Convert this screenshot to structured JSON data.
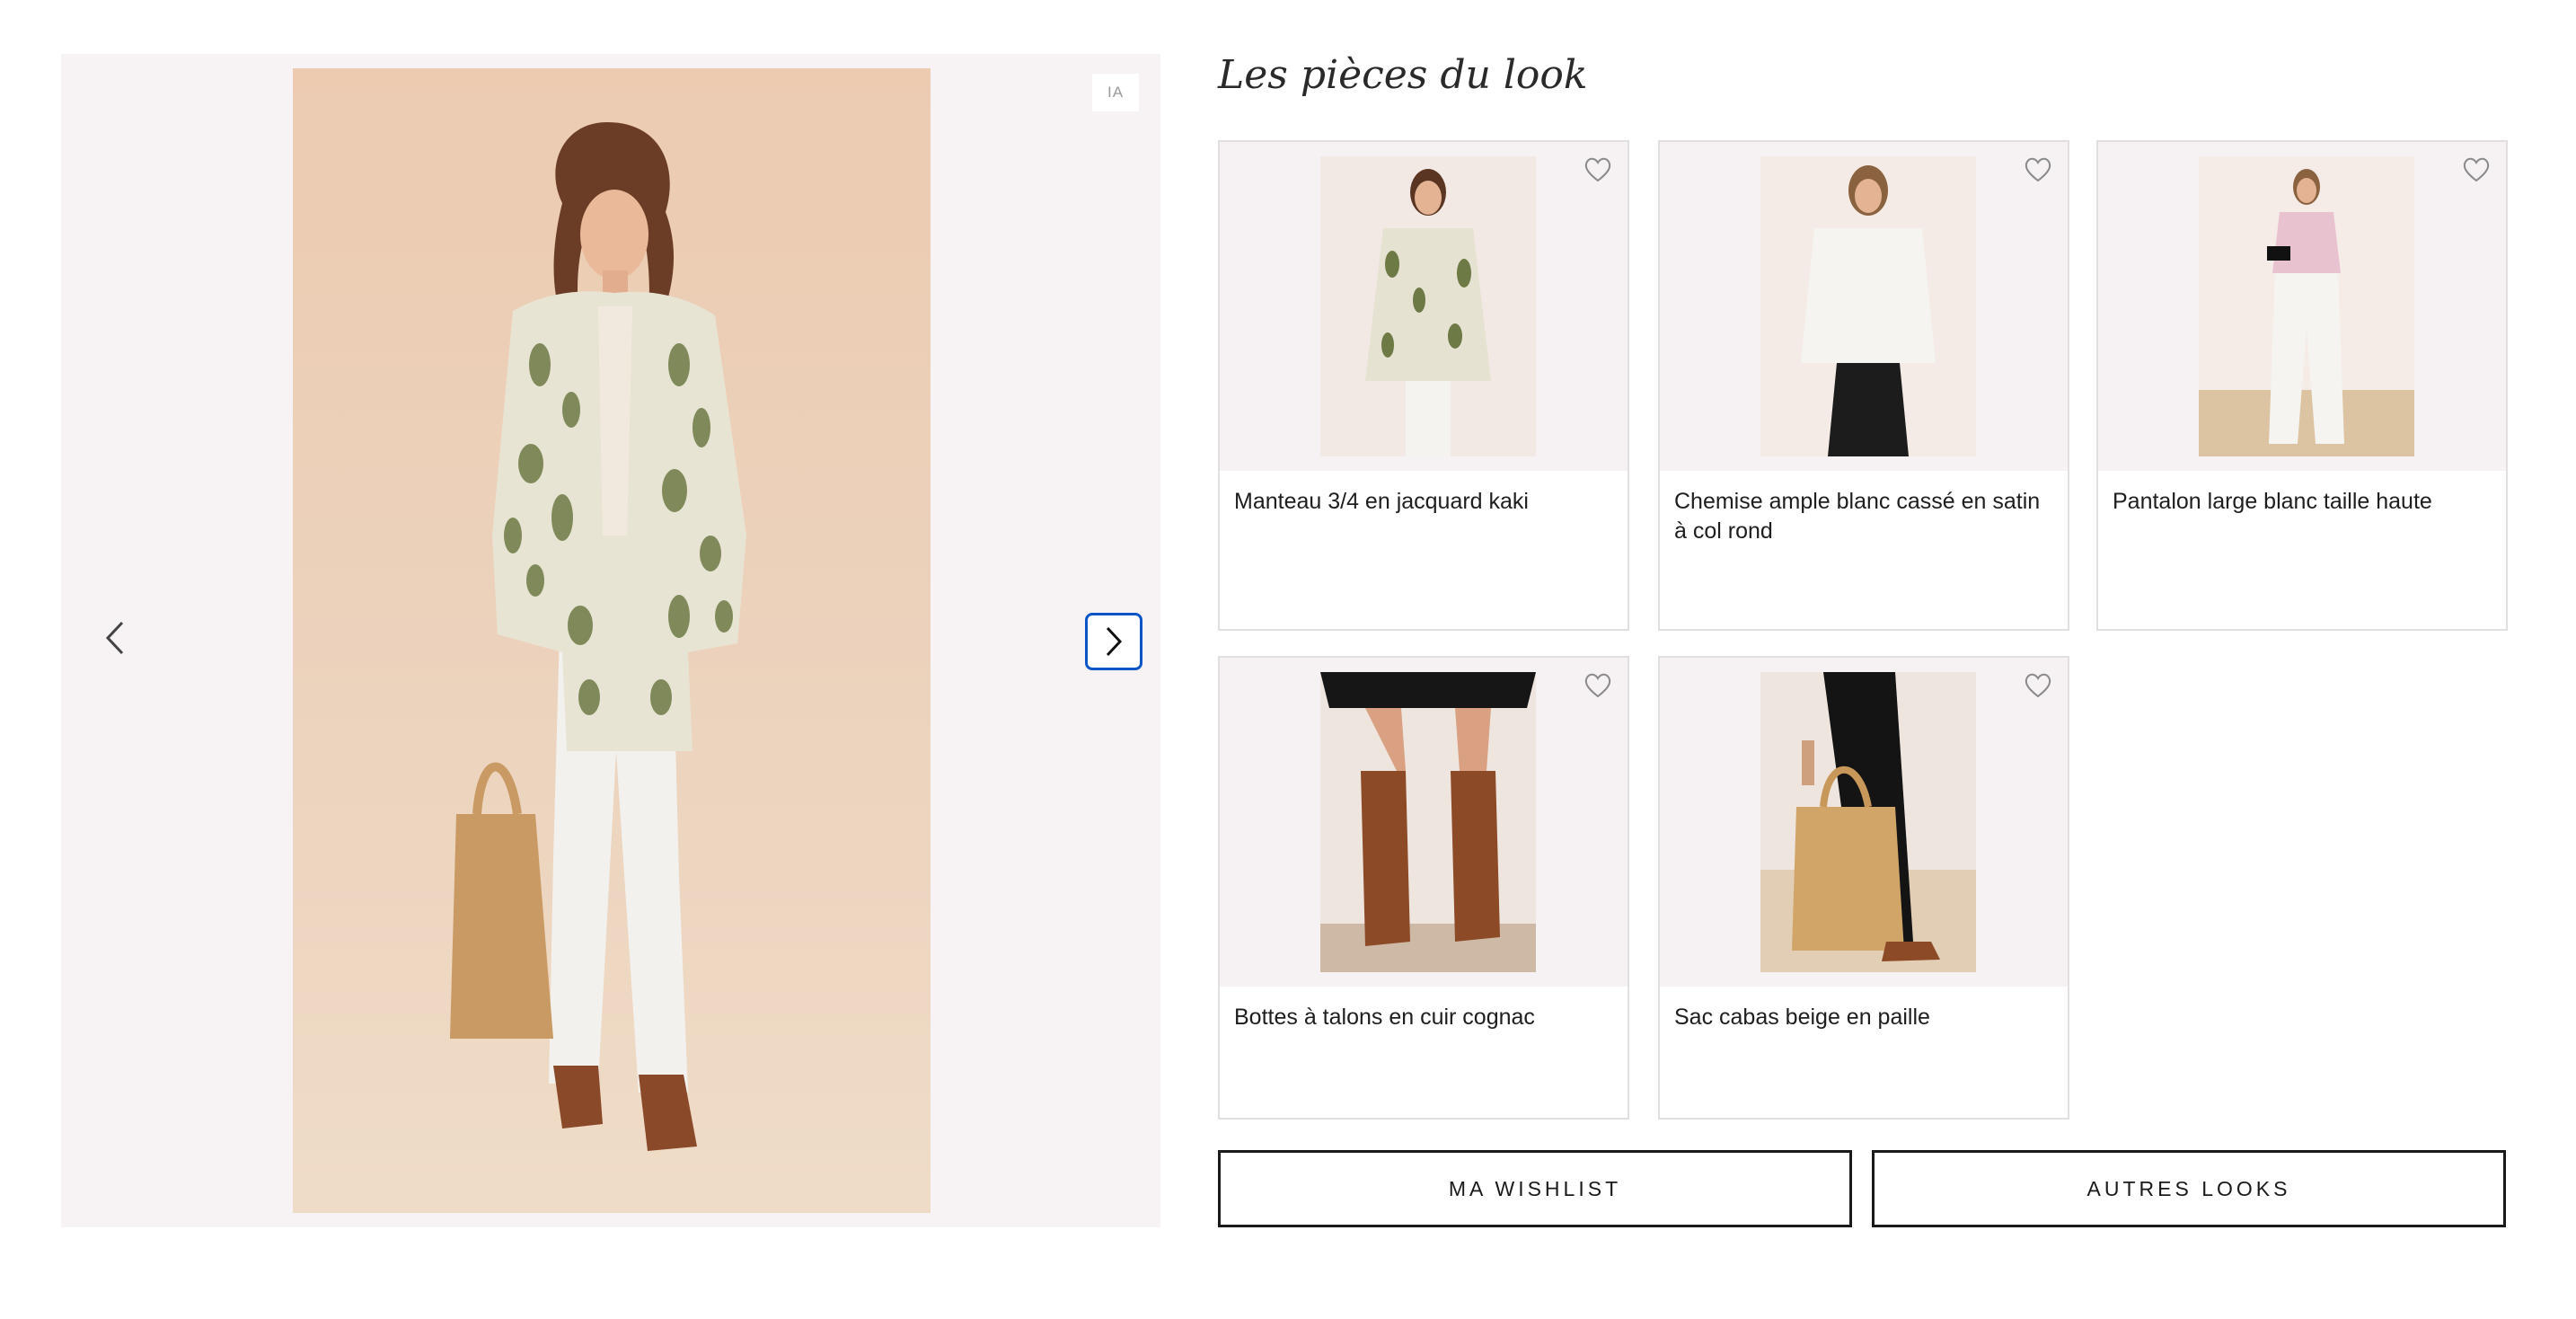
{
  "hero": {
    "badge": "IA",
    "prev_icon": "chevron-left-icon",
    "next_icon": "chevron-right-icon"
  },
  "section_title": "Les pièces du look",
  "products": [
    {
      "name": "Manteau 3/4 en jacquard kaki",
      "icon": "heart-icon"
    },
    {
      "name": "Chemise ample blanc cassé en satin à col rond",
      "icon": "heart-icon"
    },
    {
      "name": "Pantalon large blanc taille haute",
      "icon": "heart-icon"
    },
    {
      "name": "Bottes à talons en cuir cognac",
      "icon": "heart-icon"
    },
    {
      "name": "Sac cabas beige en paille",
      "icon": "heart-icon"
    }
  ],
  "actions": {
    "wishlist_label": "MA WISHLIST",
    "other_looks_label": "AUTRES LOOKS"
  },
  "colors": {
    "accent_focus": "#0b55c8",
    "panel_bg": "#f7f3f4"
  }
}
